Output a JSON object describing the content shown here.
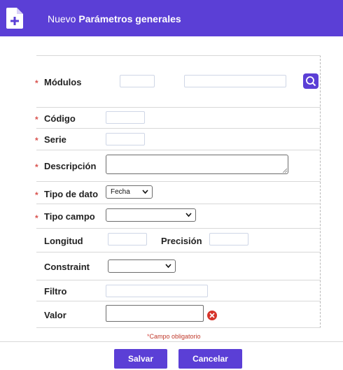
{
  "header": {
    "prefix": "Nuevo",
    "title": "Parámetros generales"
  },
  "form": {
    "modulos_label": "Módulos",
    "codigo_label": "Código",
    "serie_label": "Serie",
    "descripcion_label": "Descripción",
    "tipo_dato_label": "Tipo de dato",
    "tipo_dato_value": "Fecha",
    "tipo_campo_label": "Tipo campo",
    "tipo_campo_value": "",
    "longitud_label": "Longitud",
    "precision_label": "Precisión",
    "constraint_label": "Constraint",
    "constraint_value": "",
    "filtro_label": "Filtro",
    "valor_label": "Valor",
    "required_marker": "*"
  },
  "note": {
    "marker": "*",
    "text": "Campo obligatorio"
  },
  "buttons": {
    "save": "Salvar",
    "cancel": "Cancelar"
  },
  "colors": {
    "accent": "#5b3fd6",
    "required": "#d9534f",
    "error": "#d6342b"
  },
  "icons": [
    "document-add-icon",
    "search-icon",
    "chevron-down-icon",
    "error-clear-icon",
    "resize-grip-icon"
  ]
}
